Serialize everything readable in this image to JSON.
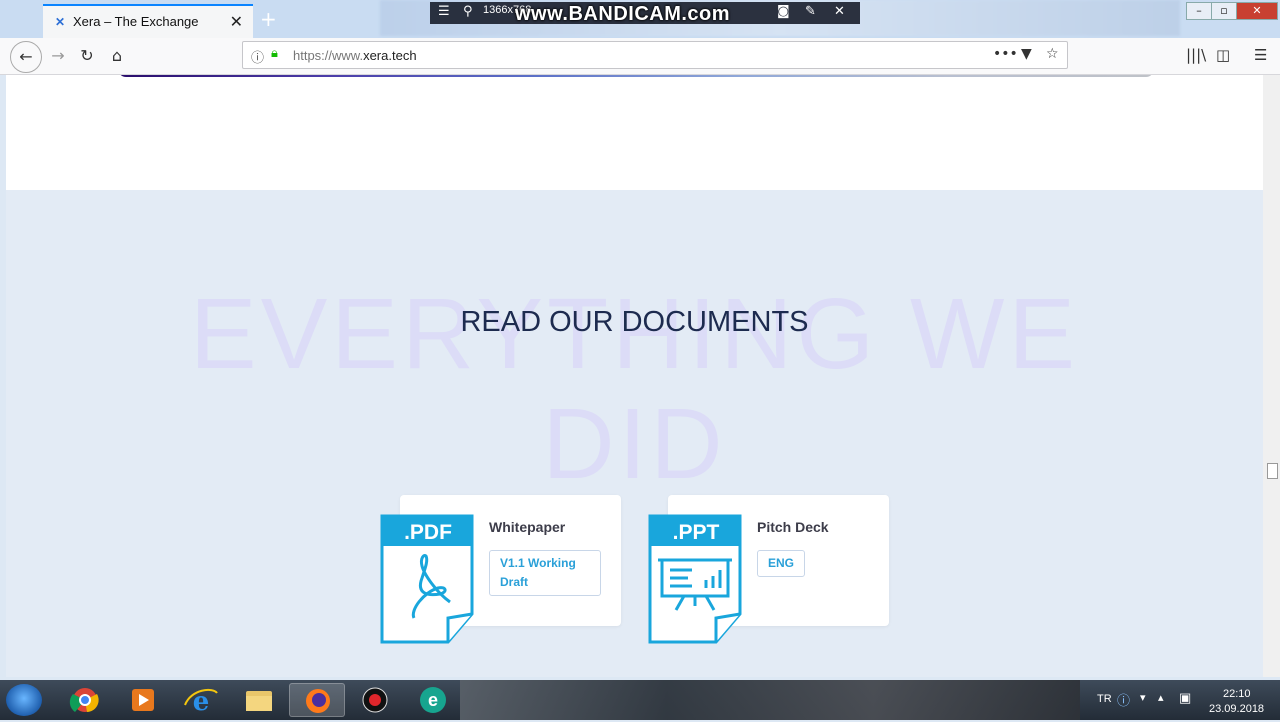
{
  "browser": {
    "tab": {
      "title": "Xera – The Exchange",
      "favicon": "x-logo-icon"
    },
    "url": {
      "prefix": "https://www.",
      "domain": "xera.tech"
    }
  },
  "overlay": {
    "recorder_logo": "www.BANDICAM.com",
    "resolution": "1366x768"
  },
  "page": {
    "background_text_line1": "EVERYTHING WE",
    "background_text_line2": "DID",
    "heading": "READ OUR DOCUMENTS",
    "documents": [
      {
        "icon_label": ".PDF",
        "title": "Whitepaper",
        "tag": "V1.1 Working Draft"
      },
      {
        "icon_label": ".PPT",
        "title": "Pitch Deck",
        "tag": "ENG"
      }
    ]
  },
  "taskbar": {
    "language": "TR",
    "time": "22:10",
    "date": "23.09.2018"
  },
  "colors": {
    "accent_cyan": "#19a6dc",
    "heading": "#1d2b4f",
    "section_bg": "#e3ebf5",
    "scroll_button": "#1b6ae6"
  }
}
